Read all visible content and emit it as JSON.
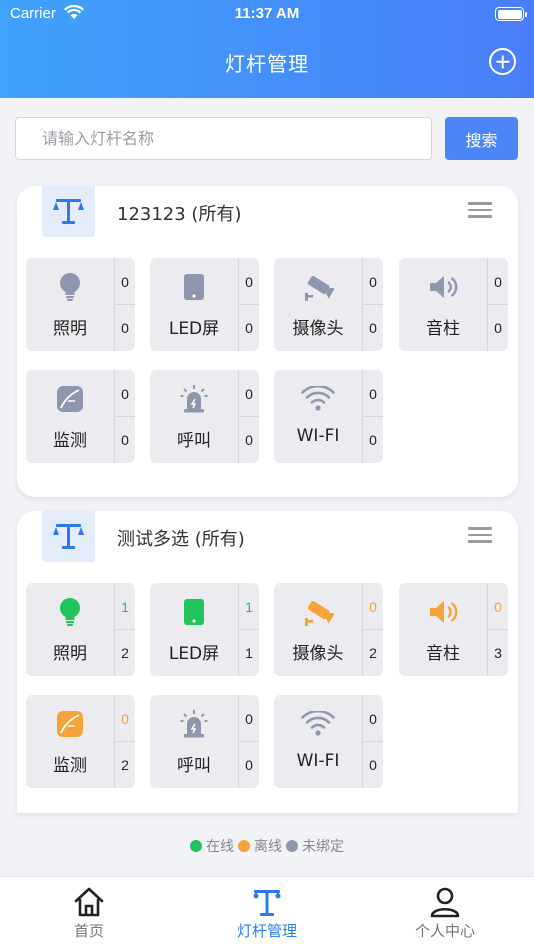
{
  "status_bar": {
    "carrier": "Carrier",
    "time": "11:37 AM"
  },
  "nav": {
    "title": "灯杆管理",
    "add_icon": "plus-circle-icon"
  },
  "search": {
    "placeholder": "请输入灯杆名称",
    "value": "",
    "button_label": "搜索"
  },
  "colors": {
    "online": "#21c45c",
    "offline": "#f7a23a",
    "unbound": "#8f97ae",
    "accent": "#2a7cf4"
  },
  "cards": [
    {
      "title": "123123 (所有)",
      "devices": [
        {
          "label": "照明",
          "icon": "bulb-icon",
          "status": "unbound",
          "top": "0",
          "bottom": "0"
        },
        {
          "label": "LED屏",
          "icon": "led-screen-icon",
          "status": "unbound",
          "top": "0",
          "bottom": "0"
        },
        {
          "label": "摄像头",
          "icon": "camera-icon",
          "status": "unbound",
          "top": "0",
          "bottom": "0"
        },
        {
          "label": "音柱",
          "icon": "speaker-icon",
          "status": "unbound",
          "top": "0",
          "bottom": "0"
        },
        {
          "label": "监测",
          "icon": "leaf-icon",
          "status": "unbound",
          "top": "0",
          "bottom": "0"
        },
        {
          "label": "呼叫",
          "icon": "alarm-icon",
          "status": "unbound",
          "top": "0",
          "bottom": "0"
        },
        {
          "label": "WI-FI",
          "icon": "wifi-icon",
          "status": "unbound",
          "top": "0",
          "bottom": "0"
        }
      ]
    },
    {
      "title": "测试多选 (所有)",
      "devices": [
        {
          "label": "照明",
          "icon": "bulb-icon",
          "status": "online",
          "top": "1",
          "bottom": "2"
        },
        {
          "label": "LED屏",
          "icon": "led-screen-icon",
          "status": "online",
          "top": "1",
          "bottom": "1"
        },
        {
          "label": "摄像头",
          "icon": "camera-icon",
          "status": "offline",
          "top": "0",
          "bottom": "2"
        },
        {
          "label": "音柱",
          "icon": "speaker-icon",
          "status": "offline",
          "top": "0",
          "bottom": "3"
        },
        {
          "label": "监测",
          "icon": "leaf-icon",
          "status": "offline",
          "top": "0",
          "bottom": "2"
        },
        {
          "label": "呼叫",
          "icon": "alarm-icon",
          "status": "unbound",
          "top": "0",
          "bottom": "0"
        },
        {
          "label": "WI-FI",
          "icon": "wifi-icon",
          "status": "unbound",
          "top": "0",
          "bottom": "0"
        }
      ]
    }
  ],
  "legend": [
    {
      "label": "在线",
      "status": "online"
    },
    {
      "label": "离线",
      "status": "offline"
    },
    {
      "label": "未绑定",
      "status": "unbound"
    }
  ],
  "tabs": [
    {
      "label": "首页",
      "icon": "home-icon",
      "active": false
    },
    {
      "label": "灯杆管理",
      "icon": "light-pole-icon",
      "active": true
    },
    {
      "label": "个人中心",
      "icon": "user-icon",
      "active": false
    }
  ]
}
